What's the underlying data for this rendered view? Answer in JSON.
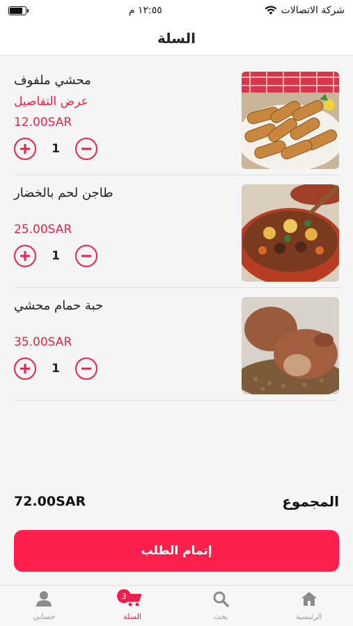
{
  "status_bar": {
    "carrier": "شركة الاتصالات",
    "time": "١٢:٥٥ م",
    "battery_level": 0.85
  },
  "header": {
    "title": "السلة"
  },
  "cart": {
    "items": [
      {
        "name": "محشي ملفوف",
        "details_label": "عرض التفاصيل",
        "price": "12.00SAR",
        "quantity": "1",
        "image": "stuffed-cabbage-rolls"
      },
      {
        "name": "طاجن لحم بالخضار",
        "details_label": "",
        "price": "25.00SAR",
        "quantity": "1",
        "image": "meat-vegetable-tagine"
      },
      {
        "name": "حبة حمام محشي",
        "details_label": "",
        "price": "35.00SAR",
        "quantity": "1",
        "image": "stuffed-pigeon"
      }
    ]
  },
  "summary": {
    "total_label": "المجموع",
    "total_amount": "72.00SAR"
  },
  "checkout": {
    "label": "إتمام الطلب"
  },
  "tabbar": {
    "items": [
      {
        "label": "الرئيسية",
        "icon": "home-icon",
        "active": false
      },
      {
        "label": "بحث",
        "icon": "search-icon",
        "active": false
      },
      {
        "label": "السلة",
        "icon": "cart-icon",
        "active": true,
        "badge": "3"
      },
      {
        "label": "حسابي",
        "icon": "user-icon",
        "active": false
      }
    ]
  },
  "colors": {
    "accent": "#ee1f4a",
    "button": "#ff1f4d",
    "background": "#f5f5f5"
  }
}
